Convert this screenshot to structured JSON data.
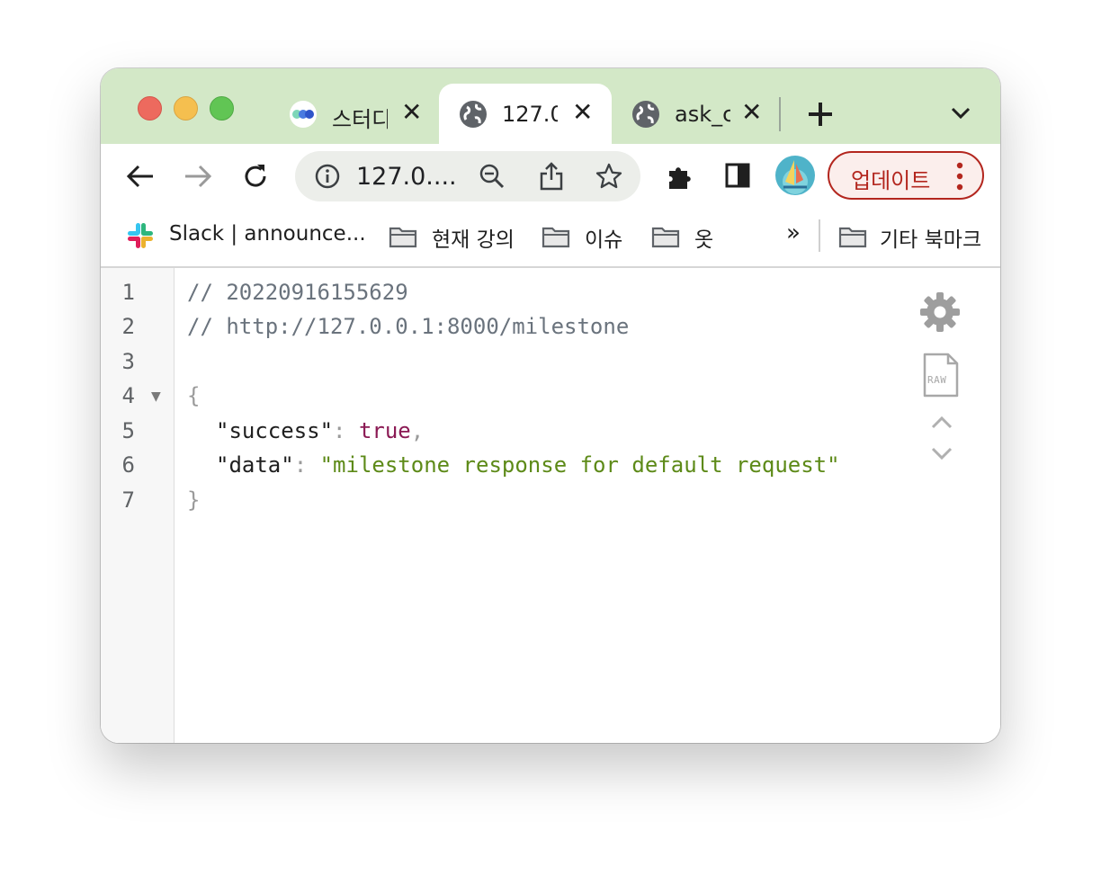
{
  "tabs": [
    {
      "label": "스터디",
      "icon": "study-favicon",
      "active": false
    },
    {
      "label": "127.0",
      "icon": "globe-icon",
      "active": true
    },
    {
      "label": "ask_c",
      "icon": "globe-icon",
      "active": false
    }
  ],
  "toolbar": {
    "url": "127.0....",
    "update_label": "업데이트"
  },
  "bookmarks": {
    "items": [
      {
        "label": "Slack | announce...",
        "icon": "slack-icon"
      },
      {
        "label": "현재 강의",
        "icon": "folder-icon"
      },
      {
        "label": "이슈",
        "icon": "folder-icon"
      },
      {
        "label": "옷",
        "icon": "folder-icon"
      }
    ],
    "overflow": "»",
    "other_label": "기타 북마크"
  },
  "json_viewer": {
    "line_numbers": [
      "1",
      "2",
      "3",
      "4",
      "5",
      "6",
      "7"
    ],
    "comment_timestamp": "// 20220916155629",
    "comment_url": "// http://127.0.0.1:8000/milestone",
    "open_brace": "{",
    "close_brace": "}",
    "success_key": "\"success\"",
    "success_value": "true",
    "data_key": "\"data\"",
    "data_value": "\"milestone response for default request\"",
    "colon": ": ",
    "comma": ",",
    "raw_label": "RAW"
  },
  "colors": {
    "titlebar": "#d3e8c7",
    "accent": "#b3261e",
    "comment": "#6a737d",
    "boolean": "#8b1a54",
    "string": "#5d8a18"
  }
}
